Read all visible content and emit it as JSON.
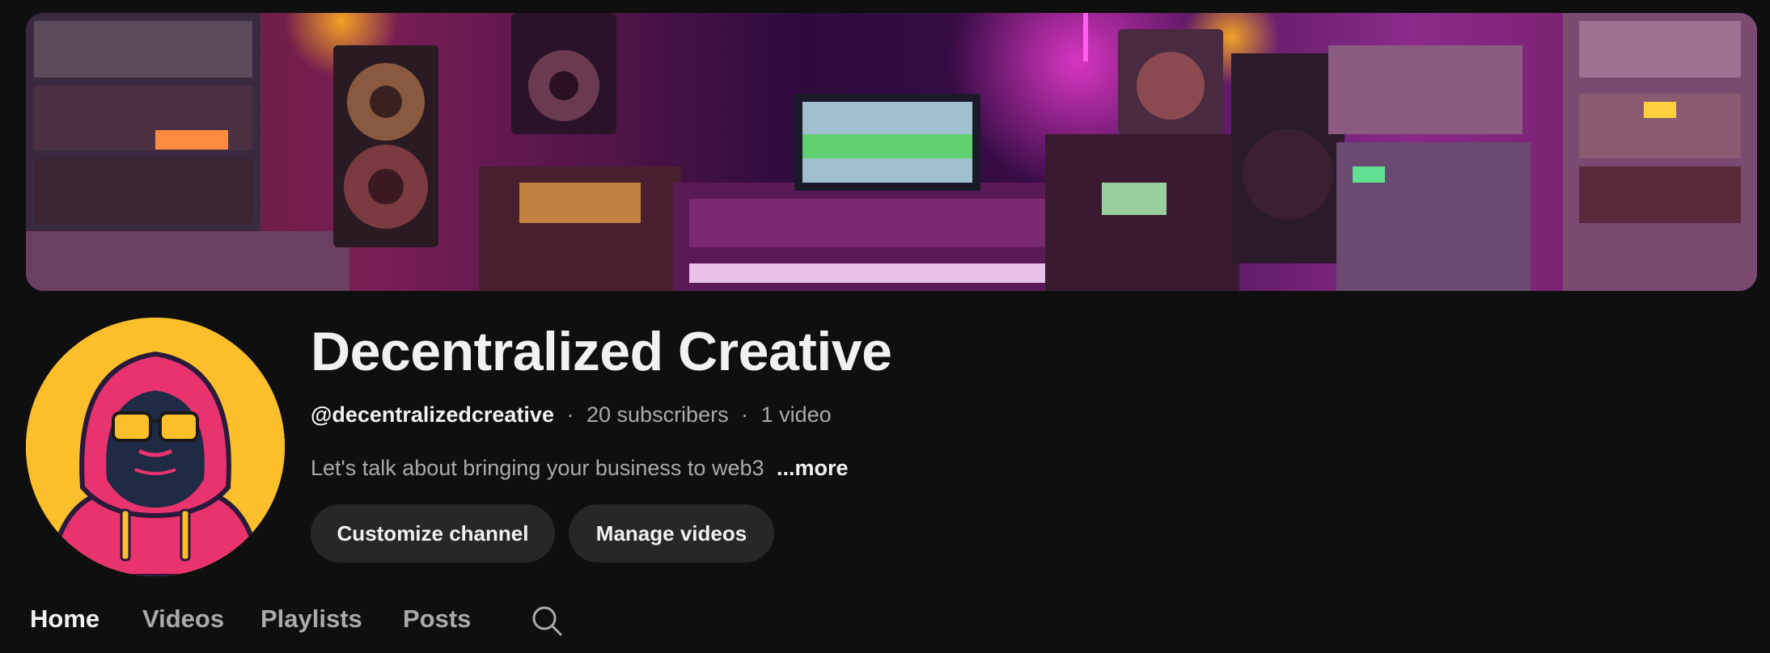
{
  "channel": {
    "name": "Decentralized Creative",
    "handle": "@decentralizedcreative",
    "subscribers": "20 subscribers",
    "videos": "1 video",
    "separator": "·",
    "description": "Let's talk about bringing your business to web3",
    "more_label": "...more"
  },
  "actions": {
    "customize_label": "Customize channel",
    "manage_label": "Manage videos"
  },
  "tabs": [
    {
      "label": "Home",
      "active": true
    },
    {
      "label": "Videos",
      "active": false
    },
    {
      "label": "Playlists",
      "active": false
    },
    {
      "label": "Posts",
      "active": false
    }
  ],
  "icons": {
    "search": "search-icon"
  },
  "colors": {
    "background": "#0f0f0f",
    "button": "#272727",
    "avatar_bg": "#fbbf2c",
    "hoodie": "#e8336f",
    "banner_accent": "#c21fb0"
  }
}
